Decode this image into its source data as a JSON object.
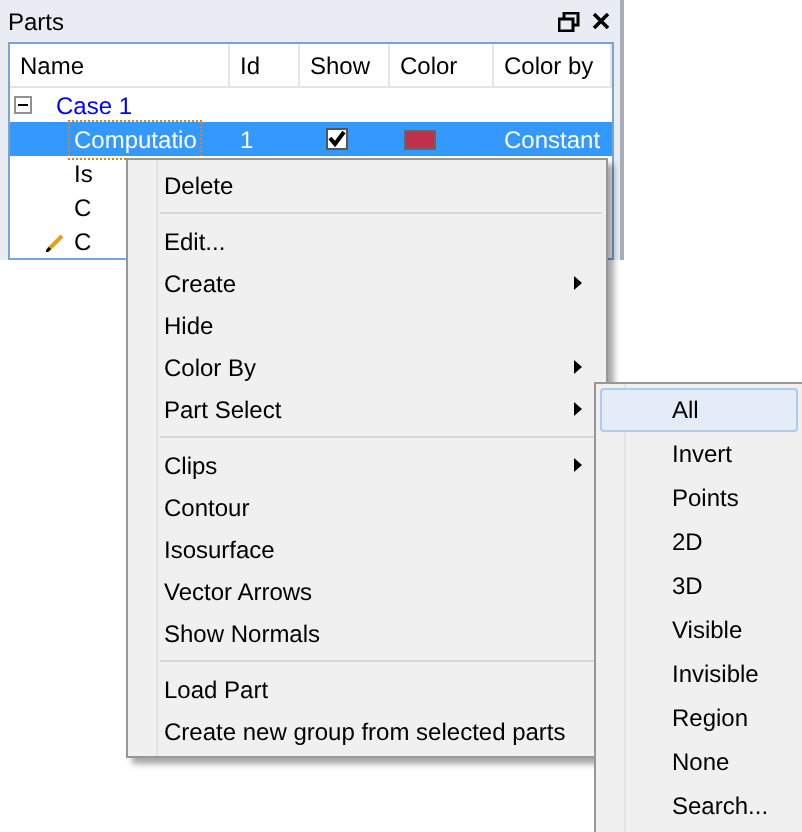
{
  "panel": {
    "title": "Parts"
  },
  "columns": [
    "Name",
    "Id",
    "Show",
    "Color",
    "Color by"
  ],
  "tree": [
    {
      "name": "Case 1",
      "expanded": true,
      "children": [
        {
          "name": "Computatio",
          "id": "1",
          "show": true,
          "color": "#c0304a",
          "color_by": "Constant",
          "selected": true,
          "editing": false
        },
        {
          "name": "Is",
          "selected": false,
          "editing": false
        },
        {
          "name": "C",
          "selected": false,
          "editing": false
        },
        {
          "name": "C",
          "selected": false,
          "editing": true
        }
      ]
    }
  ],
  "context_menu": [
    {
      "kind": "item",
      "label": "Delete",
      "submenu": false
    },
    {
      "kind": "separator"
    },
    {
      "kind": "item",
      "label": "Edit...",
      "submenu": false
    },
    {
      "kind": "item",
      "label": "Create",
      "submenu": true
    },
    {
      "kind": "item",
      "label": "Hide",
      "submenu": false
    },
    {
      "kind": "item",
      "label": "Color By",
      "submenu": true
    },
    {
      "kind": "item",
      "label": "Part Select",
      "submenu": true
    },
    {
      "kind": "separator"
    },
    {
      "kind": "item",
      "label": "Clips",
      "submenu": true
    },
    {
      "kind": "item",
      "label": "Contour",
      "submenu": false
    },
    {
      "kind": "item",
      "label": "Isosurface",
      "submenu": false
    },
    {
      "kind": "item",
      "label": "Vector Arrows",
      "submenu": false
    },
    {
      "kind": "item",
      "label": "Show Normals",
      "submenu": false
    },
    {
      "kind": "separator"
    },
    {
      "kind": "item",
      "label": "Load Part",
      "submenu": false
    },
    {
      "kind": "item",
      "label": "Create new group from selected parts",
      "submenu": false
    }
  ],
  "submenu": [
    {
      "label": "All",
      "selected": true
    },
    {
      "label": "Invert",
      "selected": false
    },
    {
      "label": "Points",
      "selected": false
    },
    {
      "label": "2D",
      "selected": false
    },
    {
      "label": "3D",
      "selected": false
    },
    {
      "label": "Visible",
      "selected": false
    },
    {
      "label": "Invisible",
      "selected": false
    },
    {
      "label": "Region",
      "selected": false
    },
    {
      "label": "None",
      "selected": false
    },
    {
      "label": "Search...",
      "selected": false
    }
  ]
}
